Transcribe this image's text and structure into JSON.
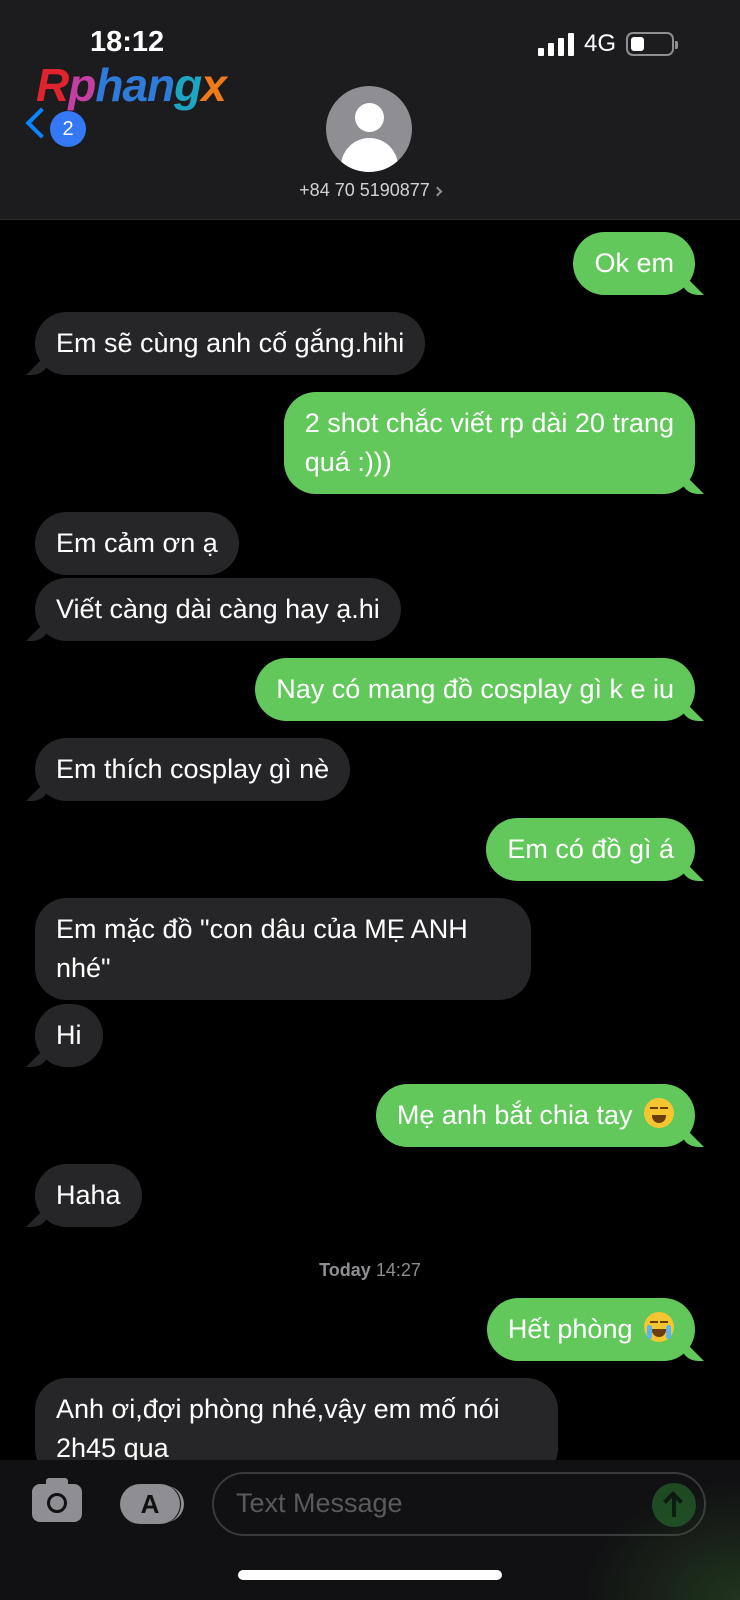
{
  "status_bar": {
    "time": "18:12",
    "network": "4G",
    "battery_level": 0.35
  },
  "watermark": {
    "part1": "R",
    "part2": "p",
    "part3": "han",
    "part4": "g",
    "part5": "x"
  },
  "header": {
    "back_badge": "2",
    "contact": "+84 70 5190877"
  },
  "messages": [
    {
      "from": "me",
      "text": "Ok em"
    },
    {
      "from": "them",
      "text": "Em sẽ cùng anh cố gắng.hihi"
    },
    {
      "from": "me",
      "line1": "2 shot chắc viết rp dài 20 trang",
      "line2": "quá :)))"
    },
    {
      "from": "them",
      "text": "Em cảm ơn ạ"
    },
    {
      "from": "them",
      "text": "Viết càng dài càng hay ạ.hi"
    },
    {
      "from": "me",
      "text": "Nay có mang đồ cosplay gì k e iu"
    },
    {
      "from": "them",
      "text": "Em thích cosplay gì nè"
    },
    {
      "from": "me",
      "text": "Em có đồ gì á"
    },
    {
      "from": "them",
      "line1": "Em mặc đồ \"con dâu của MẸ ANH",
      "line2": "nhé\""
    },
    {
      "from": "them",
      "text": "Hi"
    },
    {
      "from": "me",
      "text": "Mẹ anh bắt chia tay",
      "emoji": "grinning-squinting-face"
    },
    {
      "from": "them",
      "text": "Haha"
    },
    {
      "from": "me",
      "text": "Hết phòng",
      "emoji": "loudly-crying-face"
    },
    {
      "from": "them",
      "line1": "Anh ơi,đợi phòng nhé,vậy em mố nói",
      "line2": "2h45 qua"
    }
  ],
  "timestamp": {
    "day": "Today",
    "time": "14:27"
  },
  "input": {
    "placeholder": "Text Message"
  },
  "colors": {
    "sent_bubble": "#63c85b",
    "received_bubble": "#262628",
    "accent": "#0a84ff"
  }
}
